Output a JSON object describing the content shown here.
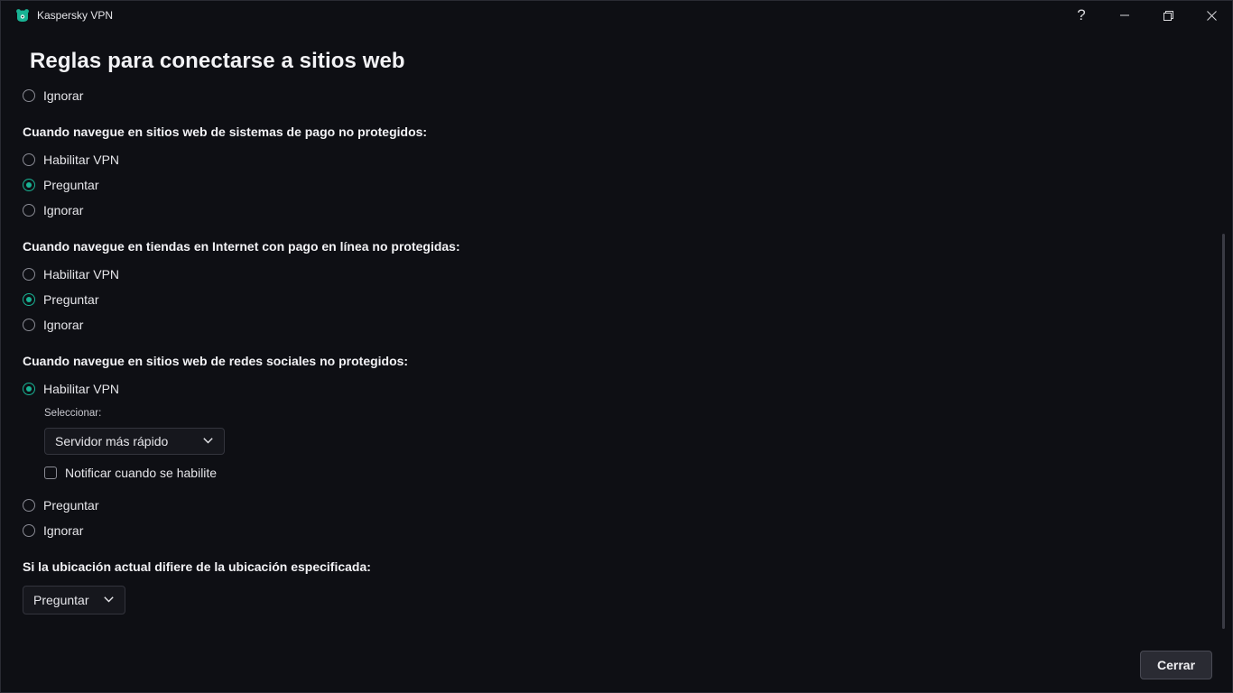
{
  "window": {
    "app_title": "Kaspersky VPN",
    "help_glyph": "?",
    "brand_color": "#19b394"
  },
  "page": {
    "title": "Reglas para conectarse a sitios web"
  },
  "top_partial": {
    "ignore_label": "Ignorar"
  },
  "payment_systems": {
    "heading": "Cuando navegue en sitios web de sistemas de pago no protegidos:",
    "options": [
      "Habilitar VPN",
      "Preguntar",
      "Ignorar"
    ],
    "selected": "Preguntar"
  },
  "online_stores": {
    "heading": "Cuando navegue en tiendas en Internet con pago en línea no protegidas:",
    "options": [
      "Habilitar VPN",
      "Preguntar",
      "Ignorar"
    ],
    "selected": "Preguntar"
  },
  "social_networks": {
    "heading": "Cuando navegue en sitios web de redes sociales no protegidos:",
    "options": [
      "Habilitar VPN",
      "Preguntar",
      "Ignorar"
    ],
    "selected": "Habilitar VPN",
    "select_label": "Seleccionar:",
    "server_value": "Servidor más rápido",
    "notify_label": "Notificar cuando se habilite",
    "notify_checked": false
  },
  "location": {
    "heading": "Si la ubicación actual difiere de la ubicación especificada:",
    "value": "Preguntar"
  },
  "footer": {
    "close_label": "Cerrar"
  },
  "icons": {
    "app": "kaspersky-bear-icon",
    "help": "help-icon",
    "minimize": "minimize-icon",
    "maximize": "restore-icon",
    "close": "close-icon",
    "dropdown": "chevron-down-icon"
  }
}
